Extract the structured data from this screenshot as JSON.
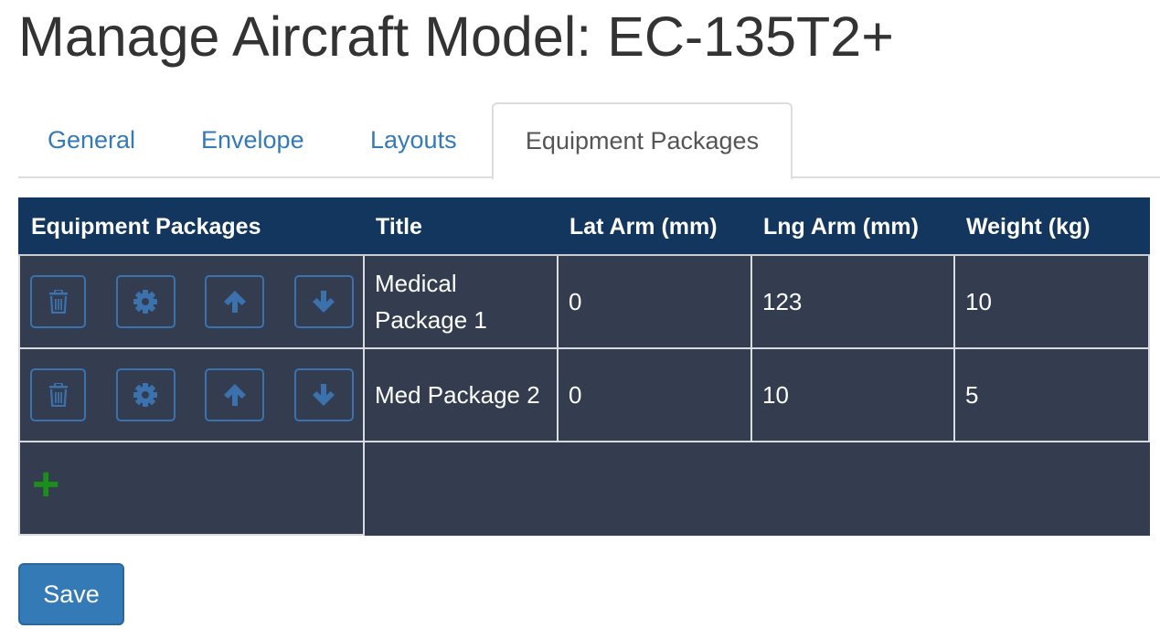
{
  "page": {
    "title": "Manage Aircraft Model: EC-135T2+"
  },
  "tabs": [
    {
      "label": "General"
    },
    {
      "label": "Envelope"
    },
    {
      "label": "Layouts"
    },
    {
      "label": "Equipment Packages",
      "active": true
    }
  ],
  "table": {
    "headers": [
      "Equipment Packages",
      "Title",
      "Lat Arm (mm)",
      "Lng Arm (mm)",
      "Weight (kg)"
    ],
    "rows": [
      {
        "title": "Medical Package 1",
        "lat_arm": "0",
        "lng_arm": "123",
        "weight": "10"
      },
      {
        "title": "Med Package 2",
        "lat_arm": "0",
        "lng_arm": "10",
        "weight": "5"
      }
    ],
    "row_actions": [
      "trash-icon",
      "gear-icon",
      "arrow-up-icon",
      "arrow-down-icon"
    ],
    "add_icon": "plus-icon"
  },
  "footer": {
    "save_label": "Save"
  },
  "colors": {
    "header_bg": "#12365d",
    "row_bg": "#343d4f",
    "link": "#337ab7",
    "add": "#1a8f1a",
    "button_border": "#3b72ad"
  }
}
